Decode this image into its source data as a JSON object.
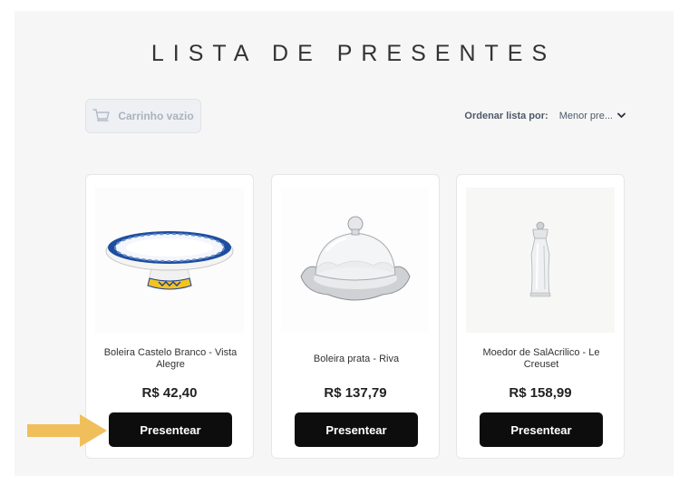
{
  "page": {
    "title": "LISTA DE PRESENTES"
  },
  "cart": {
    "label": "Carrinho vazio",
    "icon": "cart-icon"
  },
  "sort": {
    "label": "Ordenar lista por:",
    "selected": "Menor pre...",
    "icon": "chevron-down-icon"
  },
  "products": [
    {
      "name": "Boleira Castelo Branco - Vista Alegre",
      "price": "R$ 42,40",
      "button_label": "Presentear"
    },
    {
      "name": "Boleira prata - Riva",
      "price": "R$ 137,79",
      "button_label": "Presentear"
    },
    {
      "name": "Moedor de SalAcrilico - Le Creuset",
      "price": "R$ 158,99",
      "button_label": "Presentear"
    }
  ],
  "colors": {
    "accent_arrow": "#f0bf5c",
    "button_bg": "#0d0d0d",
    "panel_bg": "#f6f6f7"
  }
}
